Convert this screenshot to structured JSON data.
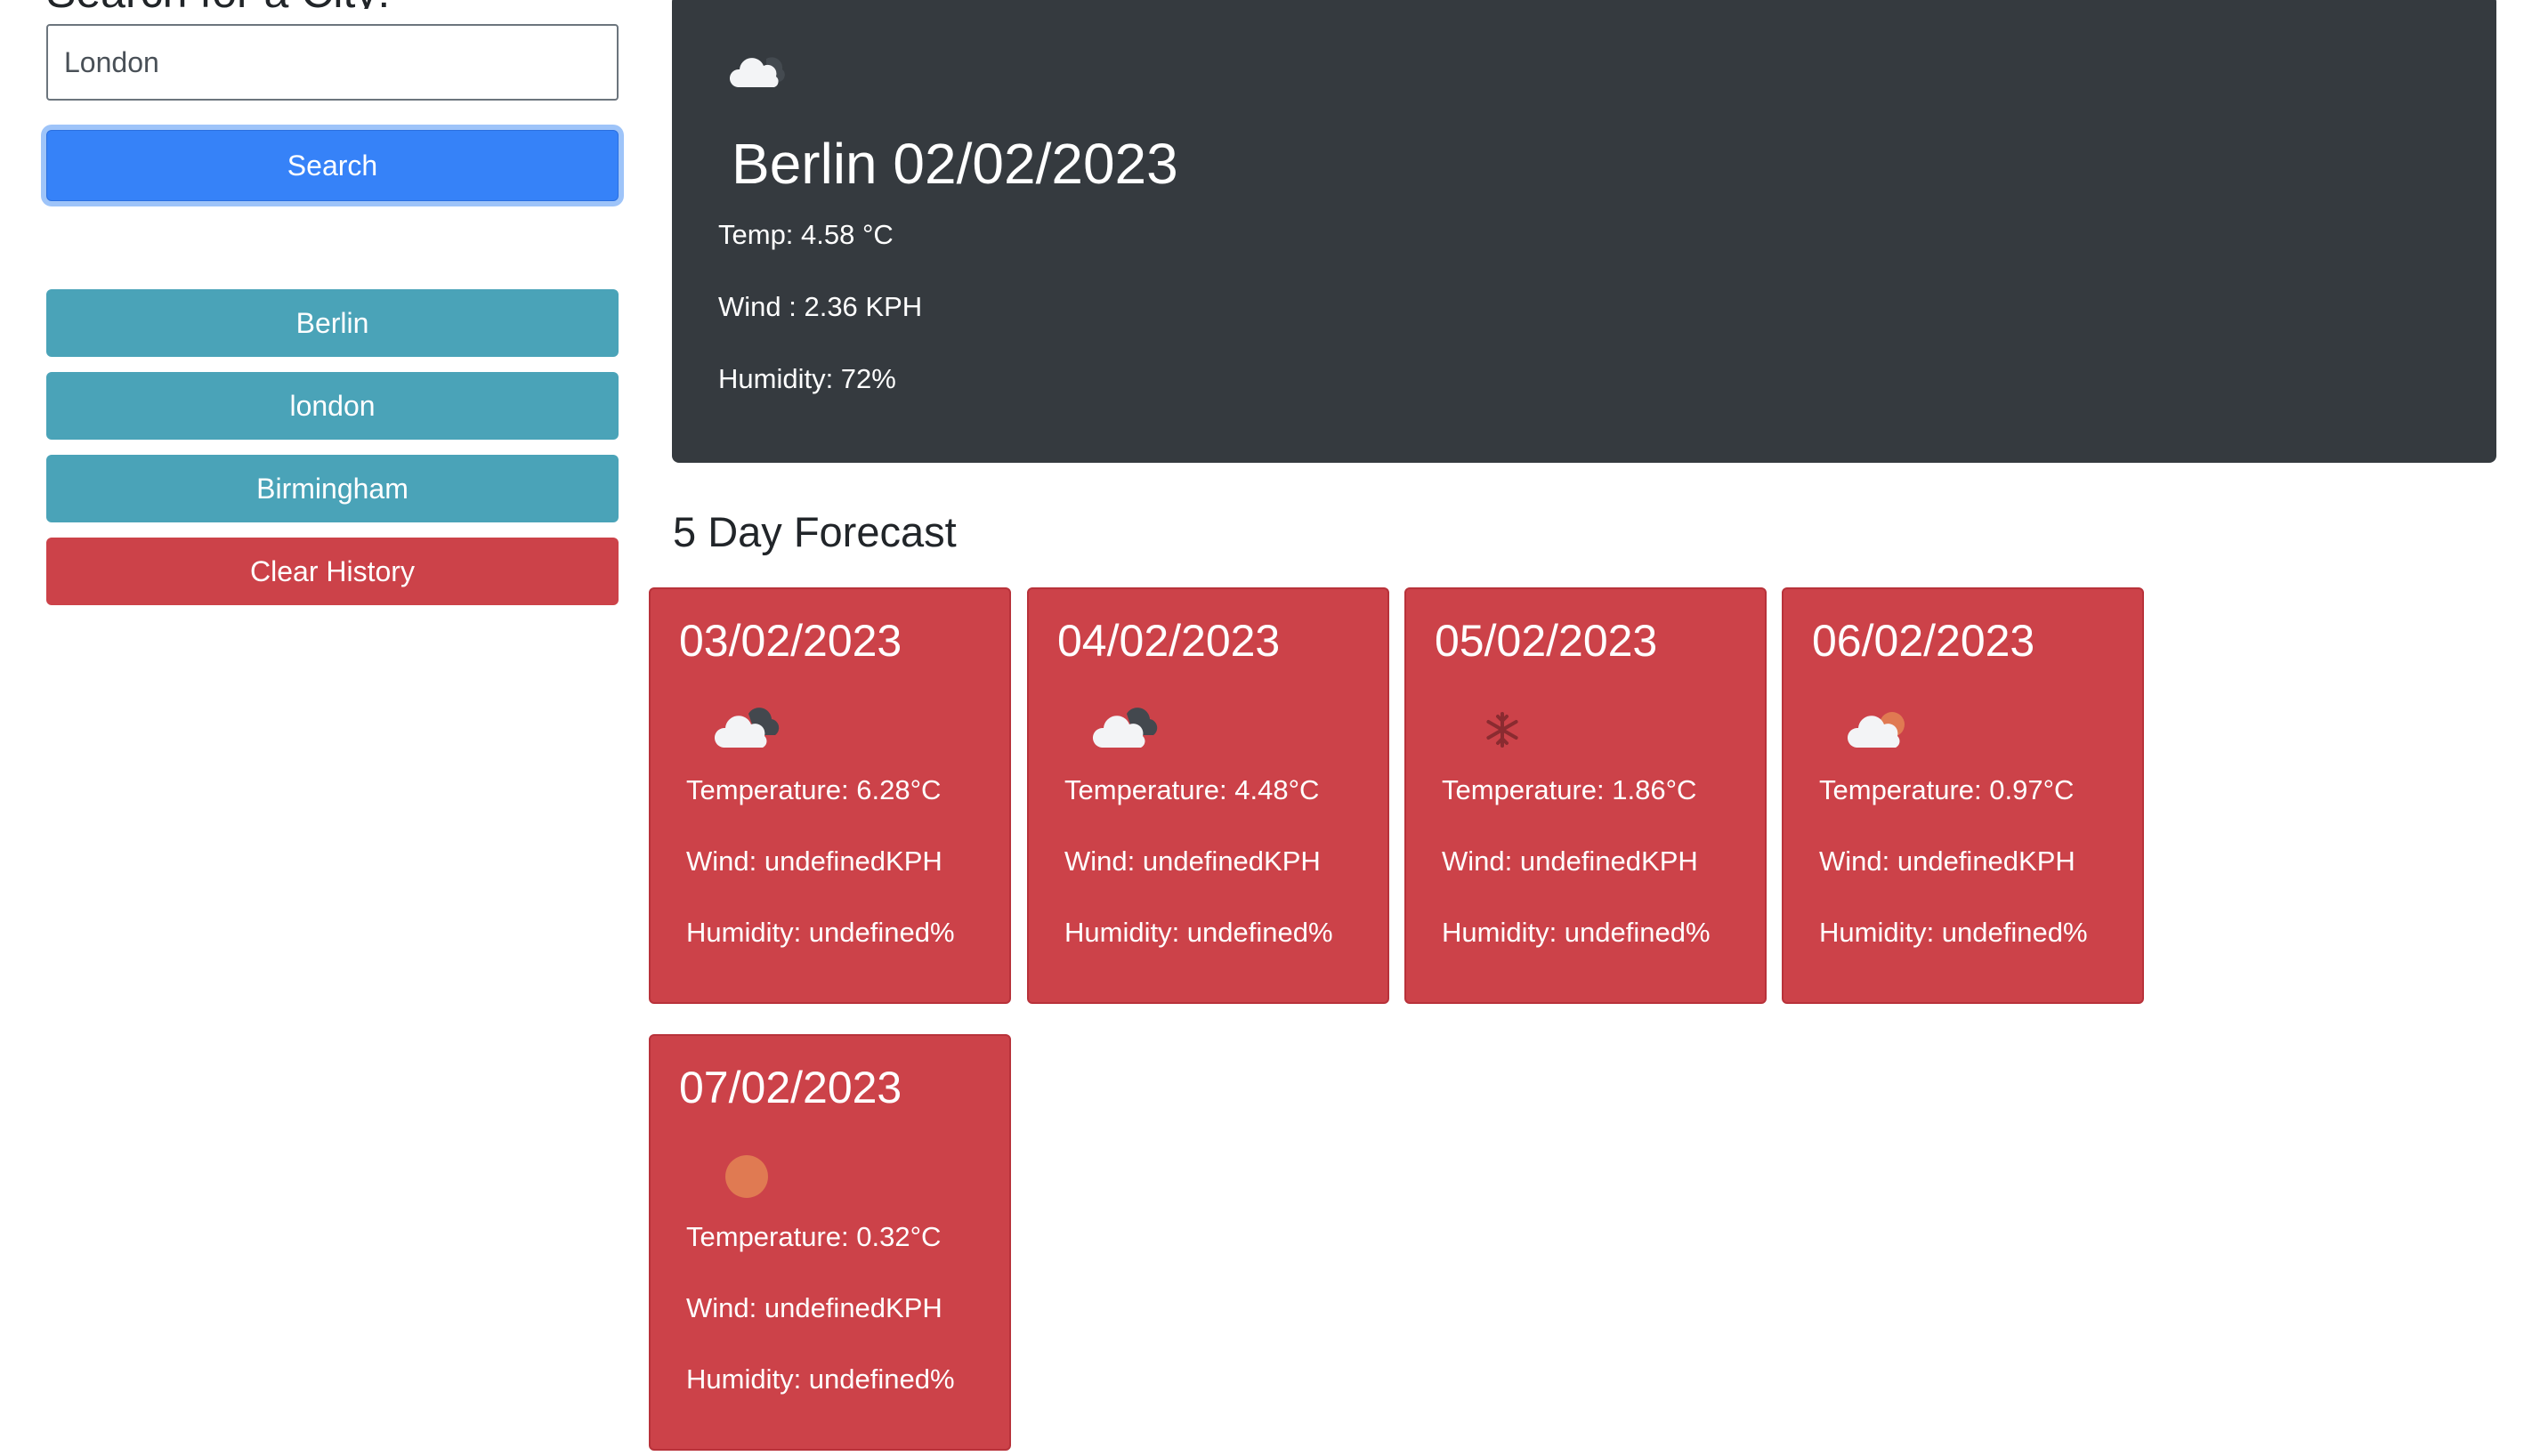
{
  "sidebar": {
    "heading": "Search for a City:",
    "search": {
      "placeholder": "London",
      "button_label": "Search"
    },
    "history": [
      "Berlin",
      "london",
      "Birmingham"
    ],
    "clear_label": "Clear History"
  },
  "current": {
    "title": "Berlin 02/02/2023",
    "icon": "cloud-icon",
    "temp": "Temp: 4.58 °C",
    "wind": "Wind : 2.36 KPH",
    "humidity": "Humidity: 72%"
  },
  "forecast": {
    "heading": "5 Day Forecast",
    "days": [
      {
        "date": "03/02/2023",
        "icon": "cloud-overcast-icon",
        "temp": "Temperature: 6.28°C",
        "wind": "Wind: undefinedKPH",
        "humidity": "Humidity: undefined%"
      },
      {
        "date": "04/02/2023",
        "icon": "cloud-overcast-icon",
        "temp": "Temperature: 4.48°C",
        "wind": "Wind: undefinedKPH",
        "humidity": "Humidity: undefined%"
      },
      {
        "date": "05/02/2023",
        "icon": "snowflake-icon",
        "temp": "Temperature: 1.86°C",
        "wind": "Wind: undefinedKPH",
        "humidity": "Humidity: undefined%"
      },
      {
        "date": "06/02/2023",
        "icon": "cloud-sun-icon",
        "temp": "Temperature: 0.97°C",
        "wind": "Wind: undefinedKPH",
        "humidity": "Humidity: undefined%"
      },
      {
        "date": "07/02/2023",
        "icon": "sun-icon",
        "temp": "Temperature: 0.32°C",
        "wind": "Wind: undefinedKPH",
        "humidity": "Humidity: undefined%"
      }
    ]
  },
  "colors": {
    "primary": "#3682f8",
    "info": "#4aa3b8",
    "danger": "#cc4249",
    "dark": "#353a3f"
  }
}
